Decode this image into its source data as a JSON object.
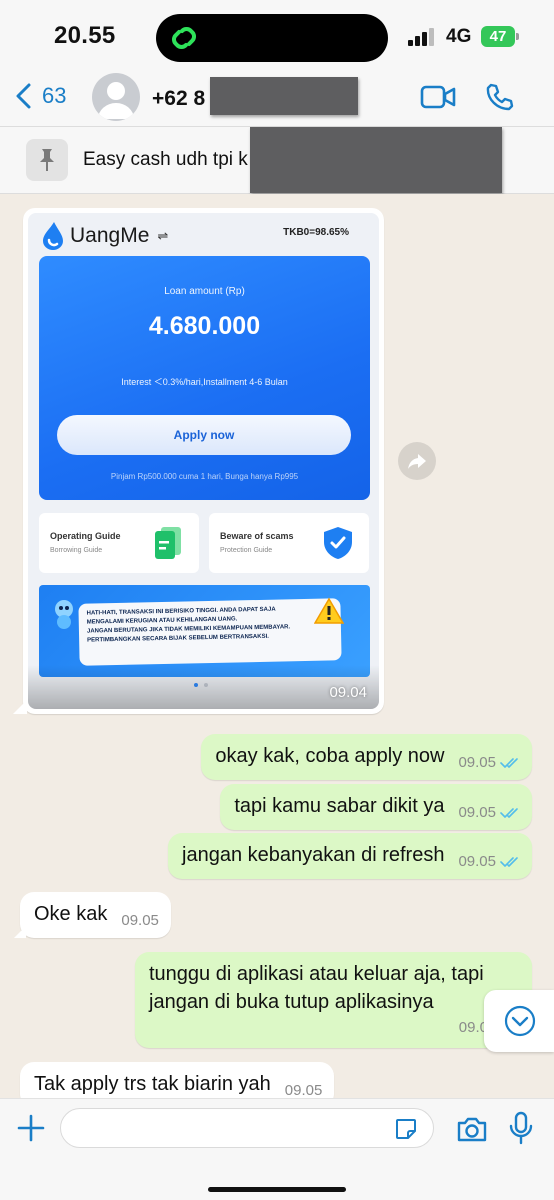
{
  "status_bar": {
    "time": "20.55",
    "network": "4G",
    "battery": "47"
  },
  "header": {
    "back_count": "63",
    "contact_name": "+62 8"
  },
  "pinned": {
    "text": "Easy cash udh tpi k                              s,..."
  },
  "shared_image": {
    "brand": "UangMe",
    "swap_symbol": "⇌",
    "tkb": "TKB0=98.65%",
    "loan_label": "Loan amount (Rp)",
    "loan_amount": "4.680.000",
    "interest": "Interest ＜0.3%/hari,Installment 4-6 Bulan",
    "apply_label": "Apply now",
    "footer_note": "Pinjam Rp500.000 cuma 1 hari, Bunga hanya Rp995",
    "guide_title": "Operating Guide",
    "guide_sub": "Borrowing Guide",
    "scam_title": "Beware of scams",
    "scam_sub": "Protection Guide",
    "banner_lines": [
      "HATI-HATI, TRANSAKSI INI BERISIKO TINGGI. ANDA DAPAT SAJA",
      "MENGALAMI KERUGIAN  ATAU KEHILANGAN UANG.",
      "JANGAN BERUTANG JIKA TIDAK MEMILIKI KEMAMPUAN MEMBAYAR.",
      "PERTIMBANGKAN SECARA BIJAK SEBELUM BERTRANSAKSI."
    ],
    "time": "09.04"
  },
  "messages": [
    {
      "direction": "out",
      "text": "okay kak, coba apply now",
      "time": "09.05",
      "read": true
    },
    {
      "direction": "out",
      "text": "tapi kamu sabar dikit ya",
      "time": "09.05",
      "read": true
    },
    {
      "direction": "out",
      "text": "jangan kebanyakan di refresh",
      "time": "09.05",
      "read": true
    },
    {
      "direction": "in",
      "text": "Oke kak",
      "time": "09.05"
    },
    {
      "direction": "out",
      "text_line1": "tunggu di aplikasi atau keluar aja, tapi",
      "text_line2": "jangan di buka tutup aplikasinya",
      "time": "09.0"
    },
    {
      "direction": "in",
      "text": "Tak apply trs tak biarin yah",
      "time": "09.05"
    }
  ],
  "input": {
    "placeholder": "",
    "value": ""
  },
  "colors": {
    "accent": "#1a7ec7",
    "outgoing_bubble": "#dcf8c6",
    "incoming_bubble": "#ffffff",
    "read_ticks": "#53bdeb",
    "app_blue": "#1b6ef3"
  }
}
